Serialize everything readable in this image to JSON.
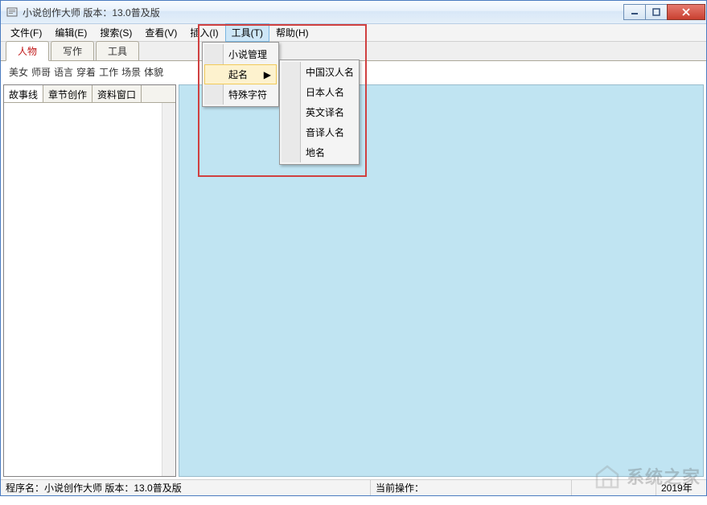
{
  "window": {
    "title": "小说创作大师 版本：13.0普及版"
  },
  "menubar": {
    "items": [
      "文件(F)",
      "编辑(E)",
      "搜索(S)",
      "查看(V)",
      "插入(I)",
      "工具(T)",
      "帮助(H)"
    ],
    "active_index": 5
  },
  "tabs": {
    "items": [
      "人物",
      "写作",
      "工具"
    ],
    "active_index": 0
  },
  "toolbar": {
    "items": [
      "美女",
      "师哥",
      "语言",
      "穿着",
      "工作",
      "场景",
      "体貌"
    ]
  },
  "left_tabs": {
    "items": [
      "故事线",
      "章节创作",
      "资料窗口"
    ],
    "active_index": 0
  },
  "dropdown1": {
    "items": [
      "小说管理",
      "起名",
      "特殊字符"
    ],
    "highlight_index": 1
  },
  "dropdown2": {
    "items": [
      "中国汉人名",
      "日本人名",
      "英文译名",
      "音译人名",
      "地名"
    ]
  },
  "statusbar": {
    "program_label": "程序名：",
    "program_value": "小说创作大师 版本：13.0普及版",
    "op_label": "当前操作：",
    "op_value": "",
    "year": "2019年"
  },
  "watermark": "系统之家"
}
